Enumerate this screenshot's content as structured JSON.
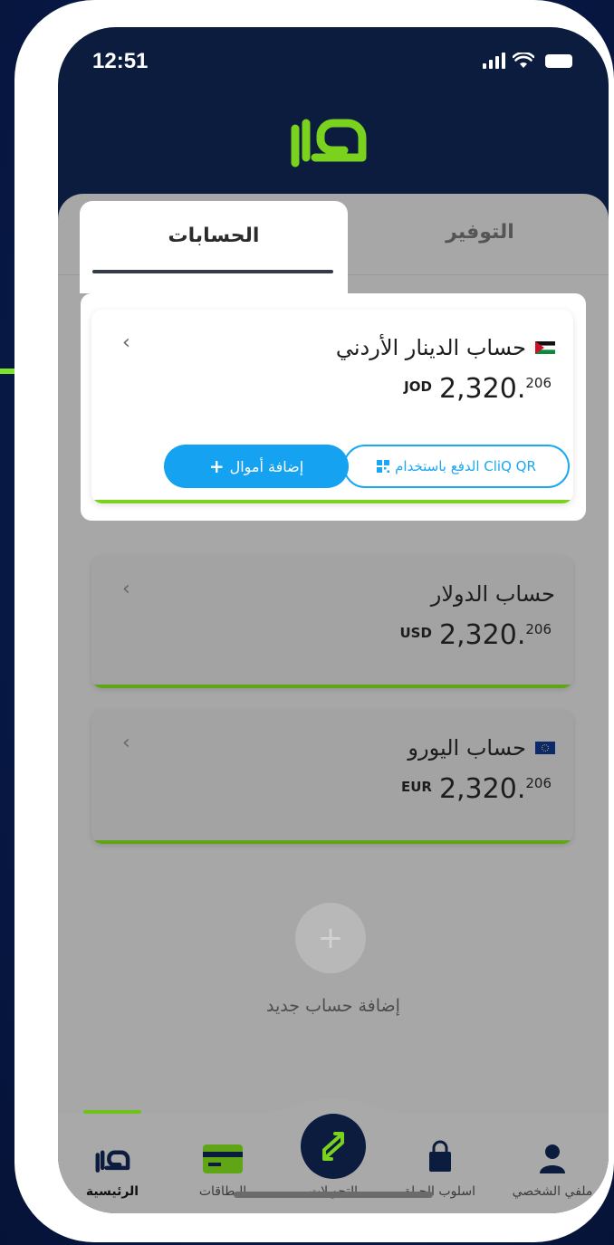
{
  "status_bar": {
    "time": "12:51"
  },
  "brand": {
    "accent_green": "#7ad11e",
    "accent_blue": "#14a2f1",
    "navy": "#0b1c3e"
  },
  "tabs": [
    {
      "label": "الحسابات",
      "active": true
    },
    {
      "label": "التوفير",
      "active": false
    }
  ],
  "accounts": [
    {
      "name": "حساب الدينار الأردني",
      "flag": "jordan-flag-icon",
      "currency": "JOD",
      "amount_main": "2,320.",
      "amount_decimals": "206",
      "actions": {
        "pay_qr": "الدفع باستخدام CliQ QR",
        "add_funds": "إضافة أموال"
      }
    },
    {
      "name": "حساب الدولار",
      "currency": "USD",
      "amount_main": "2,320.",
      "amount_decimals": "206"
    },
    {
      "name": "حساب اليورو",
      "flag": "eu-flag-icon",
      "currency": "EUR",
      "amount_main": "2,320.",
      "amount_decimals": "206"
    }
  ],
  "add_account": {
    "label": "إضافة حساب جديد"
  },
  "bottom_nav": [
    {
      "label": "الرئيسية",
      "icon": "home-logo-icon",
      "active": true
    },
    {
      "label": "البطاقات",
      "icon": "card-icon",
      "active": false
    },
    {
      "label": "التحويلات",
      "icon": "transfer-icon",
      "active": false
    },
    {
      "label": "اسلوب الحياة",
      "icon": "shopping-bag-icon",
      "active": false
    },
    {
      "label": "ملفي الشخصي",
      "icon": "user-icon",
      "active": false
    }
  ]
}
